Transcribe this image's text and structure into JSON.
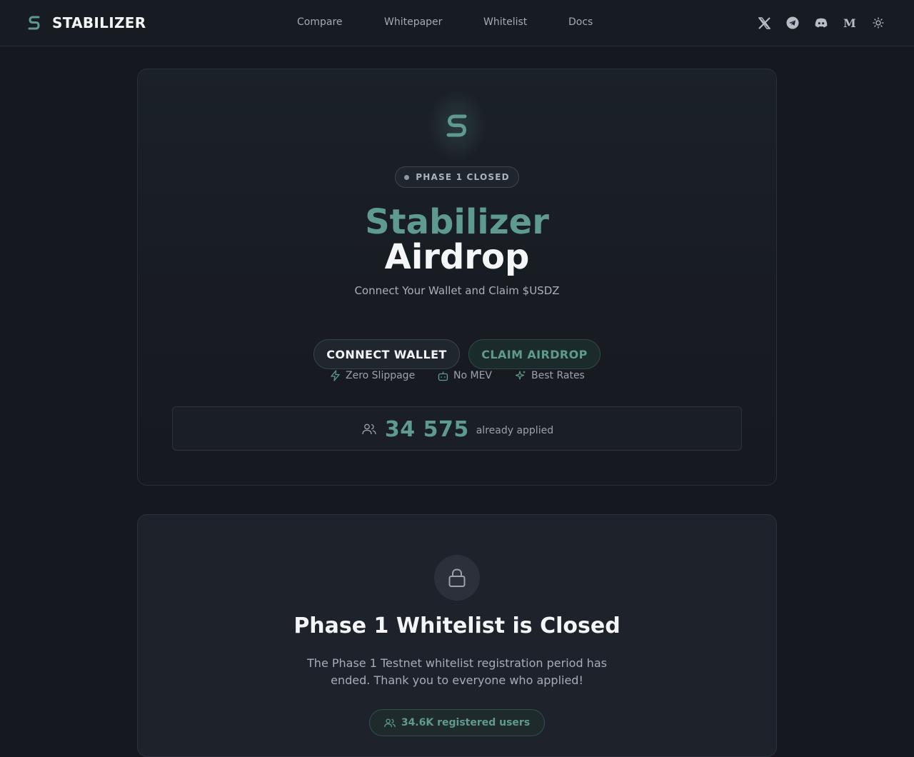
{
  "header": {
    "brand": "STABILIZER",
    "nav": [
      {
        "label": "Compare"
      },
      {
        "label": "Whitepaper"
      },
      {
        "label": "Whitelist"
      },
      {
        "label": "Docs"
      }
    ],
    "social_icons": [
      "x-icon",
      "telegram-icon",
      "discord-icon",
      "medium-icon",
      "theme-toggle-icon"
    ]
  },
  "hero": {
    "badge": "PHASE 1 CLOSED",
    "title_line1": "Stabilizer",
    "title_line2": "Airdrop",
    "subtitle": "Connect Your Wallet and Claim $USDZ",
    "connect_button": "CONNECT WALLET",
    "claim_button": "CLAIM AIRDROP",
    "features": [
      {
        "icon": "lightning-icon",
        "label": "Zero Slippage"
      },
      {
        "icon": "bot-icon",
        "label": "No MEV"
      },
      {
        "icon": "sparkles-icon",
        "label": "Best Rates"
      }
    ],
    "applied_count": "34 575",
    "applied_label": "already applied"
  },
  "whitelist": {
    "title": "Phase 1 Whitelist is Closed",
    "description": "The Phase 1 Testnet whitelist registration period has ended. Thank you to everyone who applied!",
    "registered": "34.6K registered users"
  },
  "colors": {
    "accent": "#5f9a90",
    "background": "#15181e",
    "card": "#1e222b"
  }
}
